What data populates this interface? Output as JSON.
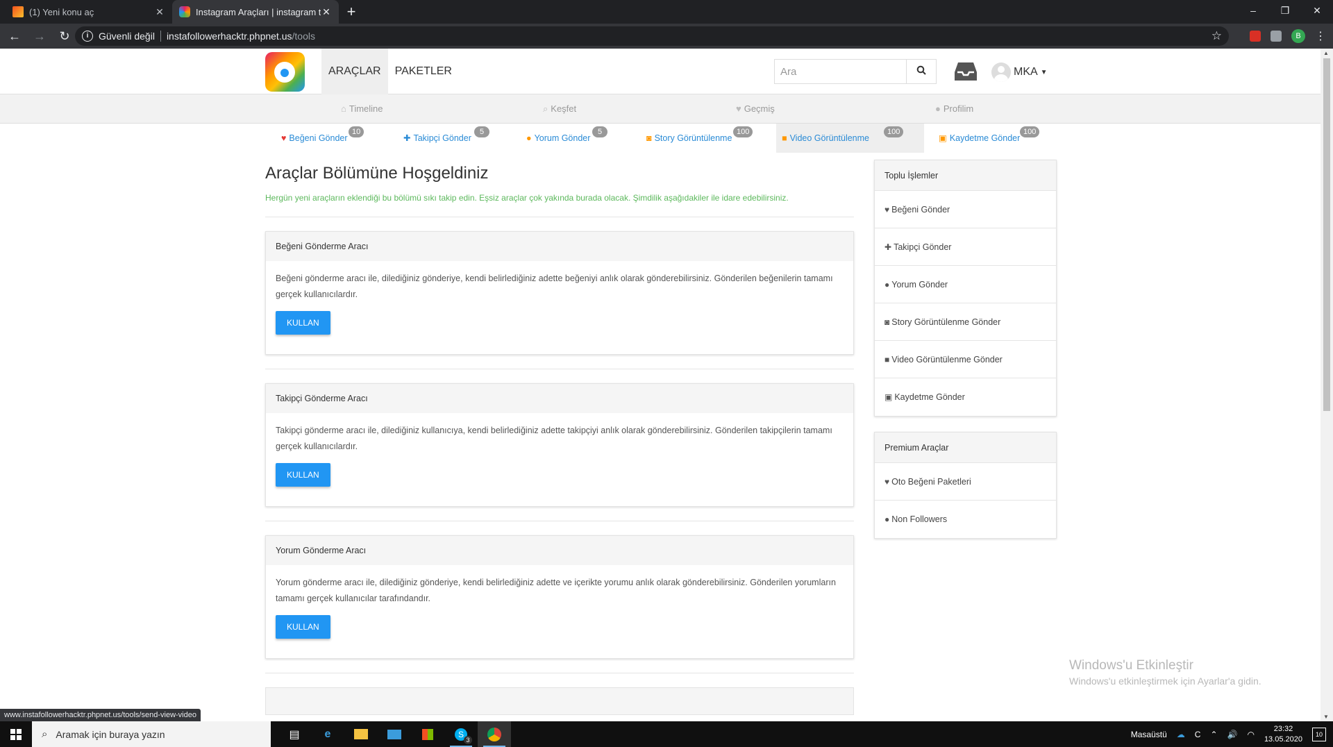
{
  "browser": {
    "tabs": [
      {
        "title": "(1) Yeni konu aç",
        "active": false
      },
      {
        "title": "Instagram Araçları | instagram tak",
        "active": true
      }
    ],
    "new_tab": "+",
    "window_controls": {
      "minimize": "–",
      "restore": "❐",
      "close": "✕"
    },
    "security_label": "Güvenli değil",
    "url_host": "instafollowerhacktr.phpnet.us",
    "url_path": "/tools",
    "profile_initial": "B"
  },
  "site": {
    "nav": [
      {
        "label": "ARAÇLAR",
        "active": true
      },
      {
        "label": "PAKETLER",
        "active": false
      }
    ],
    "search_placeholder": "Ara",
    "username": "MKA",
    "sub_nav": [
      {
        "label": "Timeline",
        "icon": "home-icon"
      },
      {
        "label": "Keşfet",
        "icon": "search-icon"
      },
      {
        "label": "Geçmiş",
        "icon": "heart-icon"
      },
      {
        "label": "Profilim",
        "icon": "user-icon"
      }
    ],
    "tool_tabs": [
      {
        "label": "Beğeni Gönder",
        "badge": "10",
        "icon": "heart-icon",
        "icon_color": "#e53935"
      },
      {
        "label": "Takipçi Gönder",
        "badge": "5",
        "icon": "user-plus-icon",
        "icon_color": "#2a8bd6"
      },
      {
        "label": "Yorum Gönder",
        "badge": "5",
        "icon": "comment-icon",
        "icon_color": "#ff9800"
      },
      {
        "label": "Story Görüntülenme",
        "badge": "100",
        "icon": "instagram-icon",
        "icon_color": "#ff9800"
      },
      {
        "label": "Video Görüntülenme",
        "badge": "100",
        "icon": "video-icon",
        "icon_color": "#ff9800",
        "active": true
      },
      {
        "label": "Kaydetme Gönder",
        "badge": "100",
        "icon": "save-icon",
        "icon_color": "#ff9800"
      }
    ]
  },
  "main": {
    "title": "Araçlar Bölümüne Hoşgeldiniz",
    "subtitle": "Hergün yeni araçların eklendiği bu bölümü sıkı takip edin. Eşsiz araçlar çok yakında burada olacak. Şimdilik aşağıdakiler ile idare edebilirsiniz.",
    "cards": [
      {
        "title": "Beğeni Gönderme Aracı",
        "text": "Beğeni gönderme aracı ile, dilediğiniz gönderiye, kendi belirlediğiniz adette beğeniyi anlık olarak gönderebilirsiniz. Gönderilen beğenilerin tamamı gerçek kullanıcılardır.",
        "button": "KULLAN"
      },
      {
        "title": "Takipçi Gönderme Aracı",
        "text": "Takipçi gönderme aracı ile, dilediğiniz kullanıcıya, kendi belirlediğiniz adette takipçiyi anlık olarak gönderebilirsiniz. Gönderilen takipçilerin tamamı gerçek kullanıcılardır.",
        "button": "KULLAN"
      },
      {
        "title": "Yorum Gönderme Aracı",
        "text": "Yorum gönderme aracı ile, dilediğiniz gönderiye, kendi belirlediğiniz adette ve içerikte yorumu anlık olarak gönderebilirsiniz. Gönderilen yorumların tamamı gerçek kullanıcılar tarafındandır.",
        "button": "KULLAN"
      }
    ]
  },
  "sidebar": {
    "bulk": {
      "title": "Toplu İşlemler",
      "items": [
        {
          "label": "Beğeni Gönder",
          "icon": "heart-icon"
        },
        {
          "label": "Takipçi Gönder",
          "icon": "user-plus-icon"
        },
        {
          "label": "Yorum Gönder",
          "icon": "comment-icon"
        },
        {
          "label": "Story Görüntülenme Gönder",
          "icon": "instagram-icon"
        },
        {
          "label": "Video Görüntülenme Gönder",
          "icon": "video-icon"
        },
        {
          "label": "Kaydetme Gönder",
          "icon": "save-icon"
        }
      ]
    },
    "premium": {
      "title": "Premium Araçlar",
      "items": [
        {
          "label": "Oto Beğeni Paketleri",
          "icon": "heartbeat-icon"
        },
        {
          "label": "Non Followers",
          "icon": "users-icon"
        }
      ]
    }
  },
  "watermark": {
    "line1": "Windows'u Etkinleştir",
    "line2": "Windows'u etkinleştirmek için Ayarlar'a gidin."
  },
  "status_url": "www.instafollowerhacktr.phpnet.us/tools/send-view-video",
  "taskbar": {
    "search_placeholder": "Aramak için buraya yazın",
    "skype_badge": "3",
    "desktop_label": "Masaüstü",
    "weather_label": "C",
    "time": "23:32",
    "date": "13.05.2020",
    "notifications": "10"
  }
}
